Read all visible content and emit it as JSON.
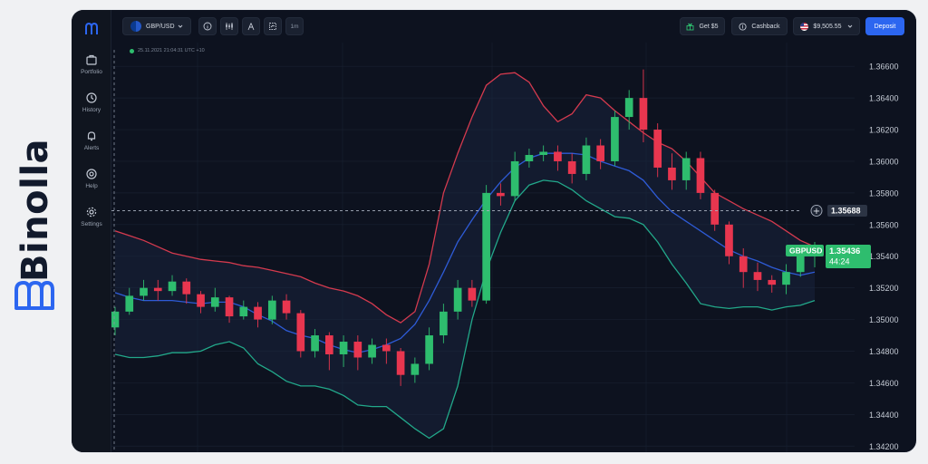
{
  "brand": {
    "name": "Binolla",
    "color": "#121a2c",
    "accent": "#2c66f0"
  },
  "sidebar": {
    "items": [
      {
        "label": "Portfolio",
        "icon": "briefcase-icon"
      },
      {
        "label": "History",
        "icon": "clock-icon"
      },
      {
        "label": "Alerts",
        "icon": "bell-icon"
      },
      {
        "label": "Help",
        "icon": "lifebuoy-icon"
      },
      {
        "label": "Settings",
        "icon": "gear-icon"
      }
    ]
  },
  "topbar": {
    "asset": "GBP/USD",
    "interval": "1m",
    "get_bonus": "Get $5",
    "cashback": "Cashback",
    "balance": "$9,505.55",
    "deposit": "Deposit"
  },
  "chart": {
    "timestamp": "25.11.2021  21:04:31  UTC +10",
    "symbol_label": "GBPUSD",
    "current_price": "1.35436",
    "countdown": "44:24",
    "crosshair_price": "1.35688",
    "colors": {
      "up": "#2ebd6e",
      "down": "#e8364f",
      "upper_band": "#d43a4e",
      "middle_band": "#2e5bd6",
      "lower_band": "#22a88a"
    }
  },
  "chart_data": {
    "type": "candlestick",
    "x_ticks": [],
    "y_ticks": [
      "1.36600",
      "1.36400",
      "1.36200",
      "1.36000",
      "1.35800",
      "1.35600",
      "1.35400",
      "1.35200",
      "1.35000",
      "1.34800",
      "1.34600",
      "1.34400",
      "1.34200"
    ],
    "ylim": [
      1.3415,
      1.3675
    ],
    "grid": true,
    "indicator": "Bollinger Bands",
    "upper_band": [
      1.3556,
      1.3553,
      1.355,
      1.3546,
      1.3542,
      1.354,
      1.3538,
      1.3537,
      1.3536,
      1.3534,
      1.3533,
      1.3531,
      1.3529,
      1.3527,
      1.3523,
      1.352,
      1.3518,
      1.3515,
      1.351,
      1.3503,
      1.3498,
      1.3505,
      1.3535,
      1.358,
      1.3605,
      1.3628,
      1.3648,
      1.3655,
      1.3656,
      1.365,
      1.3635,
      1.3625,
      1.363,
      1.3642,
      1.364,
      1.3632,
      1.3625,
      1.3618,
      1.3612,
      1.3608,
      1.36,
      1.359,
      1.358,
      1.3575,
      1.357,
      1.3566,
      1.3562,
      1.3556,
      1.355,
      1.3546
    ],
    "middle_band": [
      1.3517,
      1.3514,
      1.3512,
      1.3512,
      1.3512,
      1.3511,
      1.351,
      1.3511,
      1.3511,
      1.3508,
      1.3503,
      1.3499,
      1.3493,
      1.349,
      1.3488,
      1.3484,
      1.3481,
      1.3479,
      1.3481,
      1.3484,
      1.3488,
      1.3497,
      1.3512,
      1.353,
      1.3549,
      1.3563,
      1.3576,
      1.3587,
      1.3596,
      1.3602,
      1.3605,
      1.3605,
      1.3605,
      1.3604,
      1.36,
      1.3597,
      1.3594,
      1.3588,
      1.3577,
      1.3568,
      1.3562,
      1.3556,
      1.355,
      1.3544,
      1.354,
      1.3537,
      1.3533,
      1.353,
      1.3528,
      1.353
    ],
    "lower_band": [
      1.3478,
      1.3476,
      1.3476,
      1.3477,
      1.3479,
      1.3479,
      1.348,
      1.3484,
      1.3486,
      1.3482,
      1.3472,
      1.3467,
      1.3461,
      1.3458,
      1.3458,
      1.3456,
      1.3452,
      1.3446,
      1.3445,
      1.3445,
      1.3438,
      1.3431,
      1.3425,
      1.3431,
      1.3458,
      1.35,
      1.3531,
      1.3555,
      1.3575,
      1.3585,
      1.3588,
      1.3587,
      1.3582,
      1.3575,
      1.357,
      1.3565,
      1.3564,
      1.356,
      1.3549,
      1.3535,
      1.3523,
      1.351,
      1.3508,
      1.3507,
      1.3508,
      1.3508,
      1.3506,
      1.3508,
      1.3509,
      1.3512
    ],
    "candles": [
      [
        1.3495,
        1.3505,
        1.349,
        1.3508
      ],
      [
        1.3505,
        1.3515,
        1.3503,
        1.352
      ],
      [
        1.3515,
        1.352,
        1.3512,
        1.3525
      ],
      [
        1.352,
        1.3518,
        1.3512,
        1.3525
      ],
      [
        1.3518,
        1.3524,
        1.3515,
        1.3528
      ],
      [
        1.3524,
        1.3516,
        1.351,
        1.3526
      ],
      [
        1.3516,
        1.3508,
        1.3504,
        1.3518
      ],
      [
        1.3508,
        1.3514,
        1.3505,
        1.352
      ],
      [
        1.3514,
        1.3502,
        1.3498,
        1.3515
      ],
      [
        1.3502,
        1.3508,
        1.35,
        1.3512
      ],
      [
        1.3508,
        1.35,
        1.3495,
        1.3511
      ],
      [
        1.35,
        1.3512,
        1.3497,
        1.3515
      ],
      [
        1.3512,
        1.3504,
        1.35,
        1.3516
      ],
      [
        1.3504,
        1.348,
        1.3476,
        1.3506
      ],
      [
        1.348,
        1.349,
        1.3476,
        1.3494
      ],
      [
        1.349,
        1.3478,
        1.3468,
        1.3492
      ],
      [
        1.3478,
        1.3486,
        1.347,
        1.349
      ],
      [
        1.3486,
        1.3476,
        1.3468,
        1.349
      ],
      [
        1.3476,
        1.3484,
        1.3472,
        1.3488
      ],
      [
        1.3484,
        1.348,
        1.3472,
        1.3488
      ],
      [
        1.348,
        1.3465,
        1.3458,
        1.3482
      ],
      [
        1.3465,
        1.3472,
        1.346,
        1.3476
      ],
      [
        1.3472,
        1.349,
        1.3468,
        1.3495
      ],
      [
        1.349,
        1.3505,
        1.3485,
        1.351
      ],
      [
        1.3505,
        1.352,
        1.35,
        1.3525
      ],
      [
        1.352,
        1.3512,
        1.3508,
        1.3525
      ],
      [
        1.3512,
        1.358,
        1.351,
        1.3585
      ],
      [
        1.358,
        1.3578,
        1.3572,
        1.3586
      ],
      [
        1.3578,
        1.36,
        1.3575,
        1.3606
      ],
      [
        1.36,
        1.3604,
        1.3596,
        1.3608
      ],
      [
        1.3604,
        1.3606,
        1.36,
        1.361
      ],
      [
        1.3606,
        1.36,
        1.3594,
        1.361
      ],
      [
        1.36,
        1.3592,
        1.3586,
        1.3605
      ],
      [
        1.3592,
        1.361,
        1.3588,
        1.3615
      ],
      [
        1.361,
        1.36,
        1.3595,
        1.3614
      ],
      [
        1.36,
        1.3628,
        1.3597,
        1.3632
      ],
      [
        1.3628,
        1.364,
        1.362,
        1.3645
      ],
      [
        1.364,
        1.362,
        1.3612,
        1.3658
      ],
      [
        1.362,
        1.3596,
        1.359,
        1.3624
      ],
      [
        1.3596,
        1.3588,
        1.3582,
        1.3605
      ],
      [
        1.3588,
        1.3602,
        1.3582,
        1.3606
      ],
      [
        1.3602,
        1.358,
        1.3576,
        1.3606
      ],
      [
        1.358,
        1.356,
        1.3556,
        1.3582
      ],
      [
        1.356,
        1.354,
        1.3535,
        1.3562
      ],
      [
        1.354,
        1.353,
        1.352,
        1.3545
      ],
      [
        1.353,
        1.3525,
        1.3518,
        1.3536
      ],
      [
        1.3525,
        1.3522,
        1.3517,
        1.3528
      ],
      [
        1.3522,
        1.353,
        1.3516,
        1.3535
      ],
      [
        1.353,
        1.354,
        1.3527,
        1.3547
      ],
      [
        1.354,
        1.3543,
        1.3533,
        1.3549
      ]
    ]
  }
}
